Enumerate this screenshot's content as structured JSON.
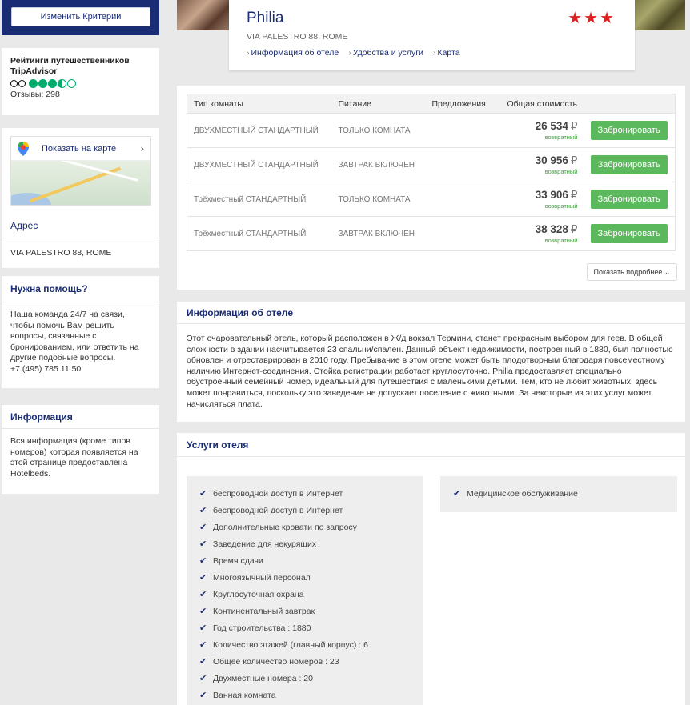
{
  "sidebar": {
    "criteria_button": "Изменить Критерии",
    "tripadvisor": {
      "title": "Рейтинги путешественников TripAdvisor",
      "rating": 3.5,
      "rating_max": 5,
      "reviews": "Отзывы: 298"
    },
    "map": {
      "label": "Показать на карте",
      "address_title": "Адрес",
      "address": "VIA PALESTRO 88, ROME"
    },
    "help": {
      "title": "Нужна помощь?",
      "text": "Наша команда 24/7 на связи, чтобы помочь Вам решить вопросы, связанные с бронированием, или ответить на другие подобные вопросы.",
      "phone": "+7 (495) 785 11 50"
    },
    "info": {
      "title": "Информация",
      "text": "Вся информация (кроме типов номеров) которая появляется на этой странице предоставлена Hotelbeds."
    }
  },
  "hotel": {
    "name": "Philia",
    "stars": "★★★",
    "address": "VIA PALESTRO 88, ROME",
    "links": [
      "Информация об отеле",
      "Удобства и услуги",
      "Карта"
    ]
  },
  "rooms": {
    "headers": [
      "Тип комнаты",
      "Питание",
      "Предложения",
      "Общая стоимость"
    ],
    "rows": [
      {
        "type": "ДВУХМЕСТНЫЙ СТАНДАРТНЫЙ",
        "board": "ТОЛЬКО КОМНАТА",
        "offer": "",
        "price": "26 534",
        "currency": "₽",
        "refund": "возвратный",
        "book": "Забронировать"
      },
      {
        "type": "ДВУХМЕСТНЫЙ СТАНДАРТНЫЙ",
        "board": "ЗАВТРАК ВКЛЮЧЕН",
        "offer": "",
        "price": "30 956",
        "currency": "₽",
        "refund": "возвратный",
        "book": "Забронировать"
      },
      {
        "type": "Трёхместный СТАНДАРТНЫЙ",
        "board": "ТОЛЬКО КОМНАТА",
        "offer": "",
        "price": "33 906",
        "currency": "₽",
        "refund": "возвратный",
        "book": "Забронировать"
      },
      {
        "type": "Трёхместный СТАНДАРТНЫЙ",
        "board": "ЗАВТРАК ВКЛЮЧЕН",
        "offer": "",
        "price": "38 328",
        "currency": "₽",
        "refund": "возвратный",
        "book": "Забронировать"
      }
    ],
    "more_button": "Показать подробнее"
  },
  "description": {
    "title": "Информация об отеле",
    "text": "Этот очаровательный отель, который расположен в Ж/д вокзал Термини, станет прекрасным выбором для геев. В общей сложности в здании насчитывается 23 спальни/спален. Данный объект недвижимости, построенный в 1880, был полностью обновлен и отреставрирован в 2010 году. Пребывание в этом отеле может быть плодотворным благодаря повсеместному наличию Интернет-соединения. Стойка регистрации работает круглосуточно. Philia предоставляет специально обустроенный семейный номер, идеальный для путешествия с маленькими детьми. Тем, кто не любит животных, здесь может понравиться, поскольку это заведение не допускает поселение с животными. За некоторые из этих услуг может начисляться плата."
  },
  "services": {
    "title": "Услуги отеля",
    "col1": [
      "беспроводной доступ в Интернет",
      "беспроводной доступ в Интернет",
      "Дополнительные кровати по запросу",
      "Заведение для некурящих",
      "Время сдачи",
      "Многоязычный персонал",
      "Круглосуточная охрана",
      "Континентальный завтрак",
      "Год строительства : 1880",
      "Количество этажей (главный корпус) : 6",
      "Общее количество номеров : 23",
      "Двухместные номера : 20",
      "Ванная комната"
    ],
    "col2": [
      "Медицинское обслуживание"
    ]
  }
}
